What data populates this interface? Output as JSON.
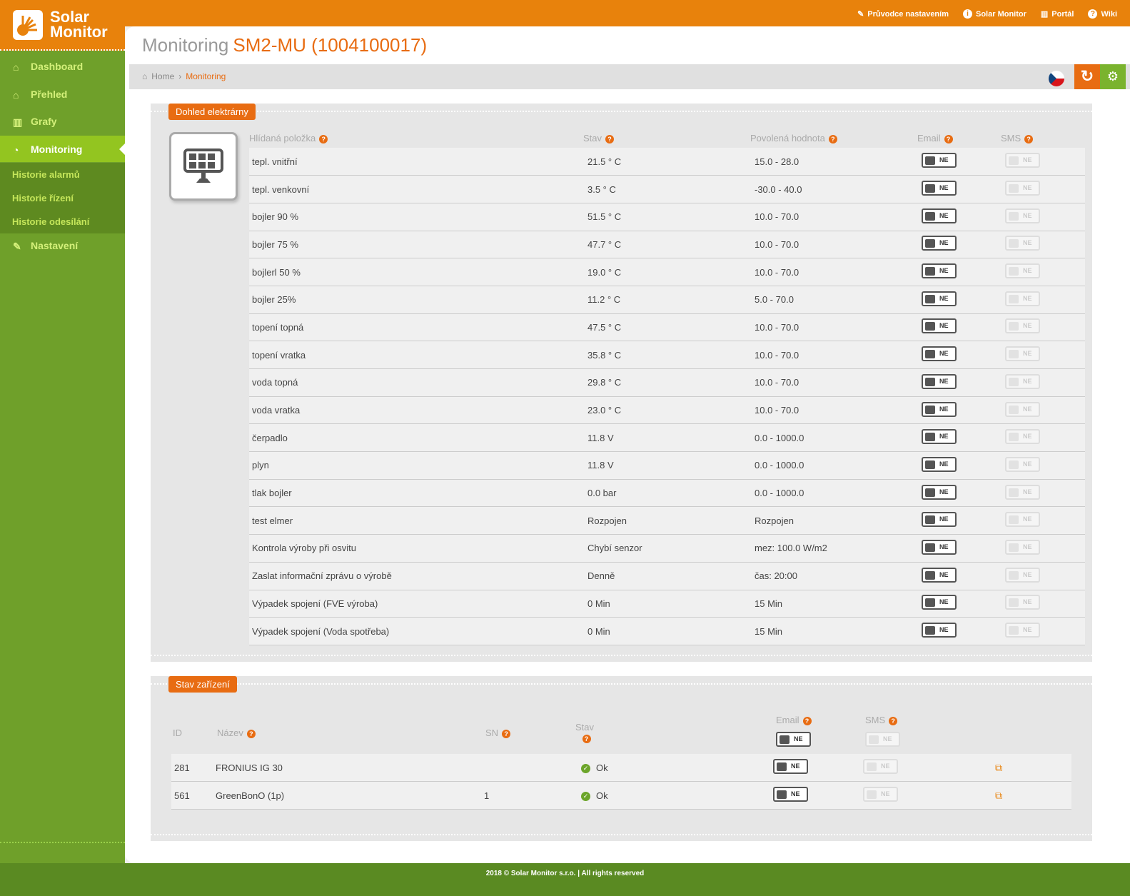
{
  "brand": {
    "line1": "Solar",
    "line2": "Monitor"
  },
  "toplinks": [
    {
      "label": "Průvodce nastavením",
      "icon": "wand-icon"
    },
    {
      "label": "Solar Monitor",
      "icon": "info-icon"
    },
    {
      "label": "Portál",
      "icon": "bar-chart-icon"
    },
    {
      "label": "Wiki",
      "icon": "question-icon"
    }
  ],
  "nav": {
    "dashboard": "Dashboard",
    "prehled": "Přehled",
    "grafy": "Grafy",
    "monitoring": "Monitoring",
    "sub": [
      "Historie alarmů",
      "Historie řízení",
      "Historie odesílání"
    ],
    "nastaveni": "Nastavení"
  },
  "page": {
    "title": "Monitoring",
    "device": "SM2-MU (1004100017)"
  },
  "breadcrumb": {
    "home": "Home",
    "current": "Monitoring"
  },
  "colors": {
    "orange": "#e86c12",
    "green": "#6fa02a",
    "light_green": "#93c520"
  },
  "monitor": {
    "tag": "Dohled elektrárny",
    "headers": {
      "item": "Hlídaná položka",
      "state": "Stav",
      "allowed": "Povolená hodnota",
      "email": "Email",
      "sms": "SMS"
    },
    "toggle_label": "NE",
    "rows": [
      {
        "item": "tepl. vnitřní",
        "state": "21.5 ° C",
        "allowed": "15.0 - 28.0"
      },
      {
        "item": "tepl. venkovní",
        "state": "3.5 ° C",
        "allowed": "-30.0 - 40.0"
      },
      {
        "item": "bojler 90 %",
        "state": "51.5 ° C",
        "allowed": "10.0 - 70.0"
      },
      {
        "item": "bojler 75 %",
        "state": "47.7 ° C",
        "allowed": "10.0 - 70.0"
      },
      {
        "item": "bojlerl 50 %",
        "state": "19.0 ° C",
        "allowed": "10.0 - 70.0"
      },
      {
        "item": "bojler 25%",
        "state": "11.2 ° C",
        "allowed": "5.0 - 70.0"
      },
      {
        "item": "topení topná",
        "state": "47.5 ° C",
        "allowed": "10.0 - 70.0"
      },
      {
        "item": "topení vratka",
        "state": "35.8 ° C",
        "allowed": "10.0 - 70.0"
      },
      {
        "item": "voda topná",
        "state": "29.8 ° C",
        "allowed": "10.0 - 70.0"
      },
      {
        "item": "voda vratka",
        "state": "23.0 ° C",
        "allowed": "10.0 - 70.0"
      },
      {
        "item": "čerpadlo",
        "state": "11.8 V",
        "allowed": "0.0 - 1000.0"
      },
      {
        "item": "plyn",
        "state": "11.8 V",
        "allowed": "0.0 - 1000.0"
      },
      {
        "item": "tlak bojler",
        "state": "0.0 bar",
        "allowed": "0.0 - 1000.0"
      },
      {
        "item": "test elmer",
        "state": "Rozpojen",
        "allowed": "Rozpojen"
      },
      {
        "item": "Kontrola výroby při osvitu",
        "state": "Chybí senzor",
        "allowed": "mez: 100.0 W/m2"
      },
      {
        "item": "Zaslat informační zprávu o výrobě",
        "state": "Denně",
        "allowed": "čas: 20:00"
      },
      {
        "item": "Výpadek spojení (FVE výroba)",
        "state": "0 Min",
        "allowed": "15 Min"
      },
      {
        "item": "Výpadek spojení (Voda spotřeba)",
        "state": "0 Min",
        "allowed": "15 Min"
      }
    ]
  },
  "devices": {
    "tag": "Stav zařízení",
    "headers": {
      "id": "ID",
      "name": "Název",
      "sn": "SN",
      "state": "Stav",
      "email": "Email",
      "sms": "SMS"
    },
    "rows": [
      {
        "id": "281",
        "name": "FRONIUS IG 30",
        "sn": "",
        "state": "Ok"
      },
      {
        "id": "561",
        "name": "GreenBonO (1p)",
        "sn": "1",
        "state": "Ok"
      }
    ]
  },
  "footer": "2018 © Solar Monitor s.r.o. | All rights reserved"
}
